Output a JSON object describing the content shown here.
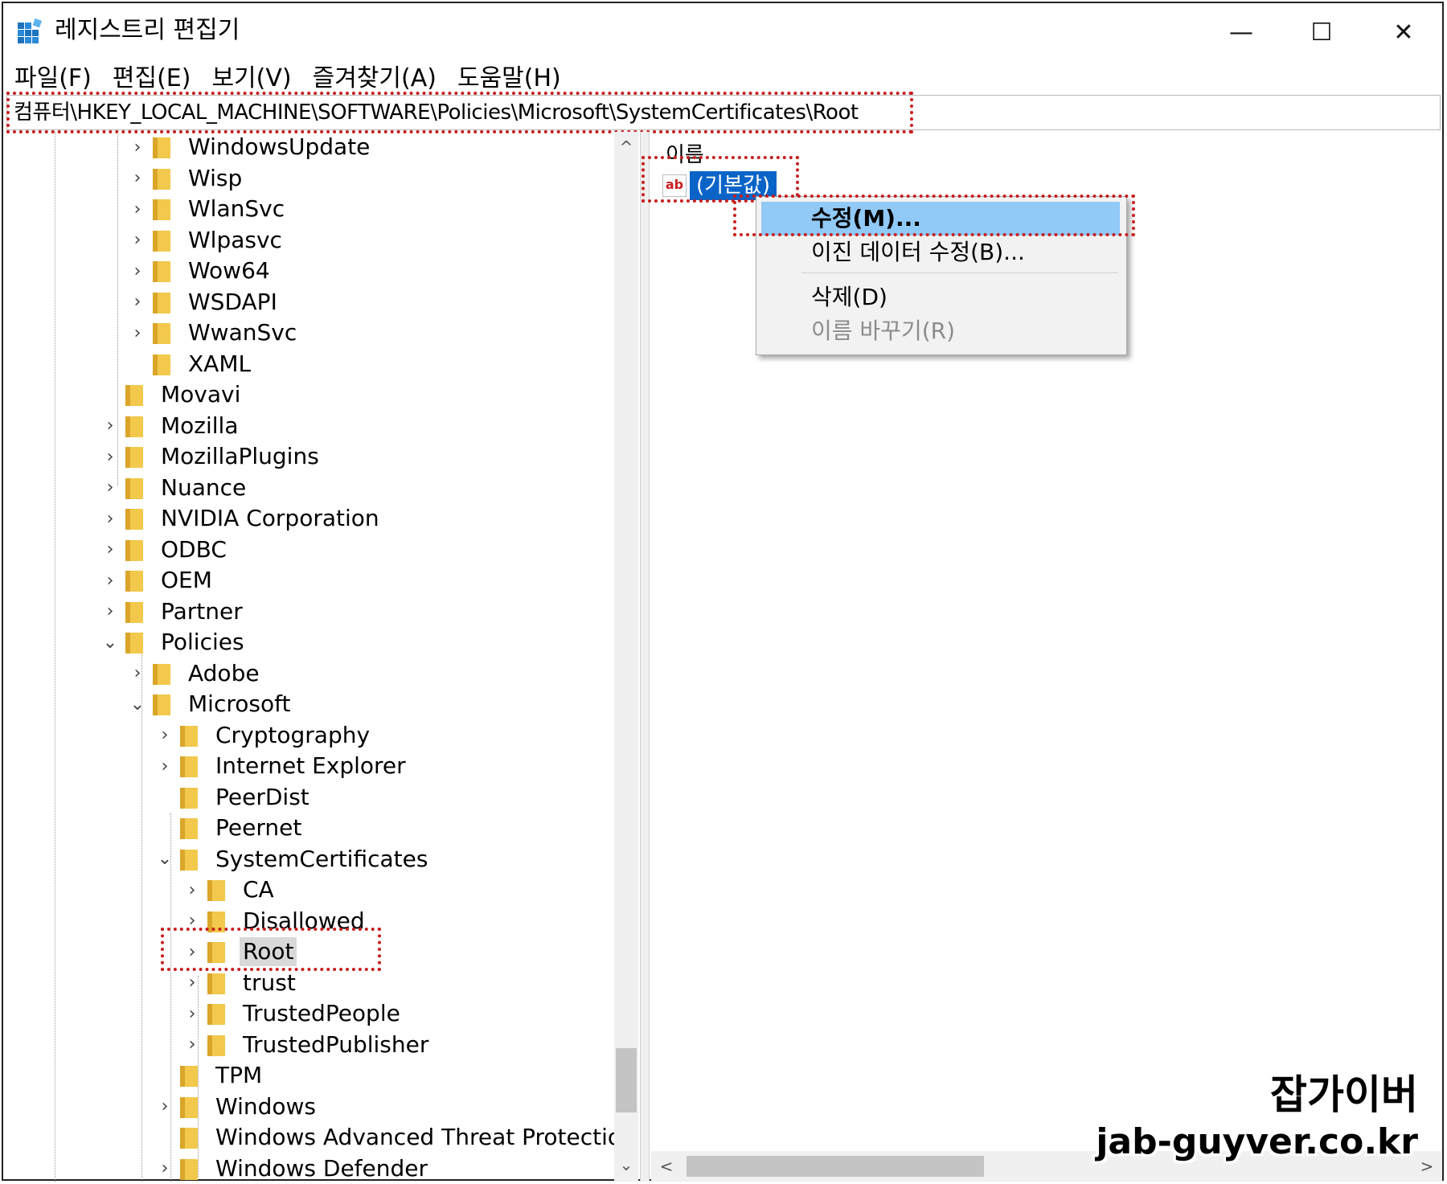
{
  "window": {
    "title": "레지스트리 편집기",
    "minimize": "—",
    "maximize": "☐",
    "close": "✕"
  },
  "menu": [
    "파일(F)",
    "편집(E)",
    "보기(V)",
    "즐겨찾기(A)",
    "도움말(H)"
  ],
  "address": "컴퓨터\\HKEY_LOCAL_MACHINE\\SOFTWARE\\Policies\\Microsoft\\SystemCertificates\\Root",
  "tree": [
    {
      "label": "WindowsUpdate",
      "expander": "›"
    },
    {
      "label": "Wisp",
      "expander": "›"
    },
    {
      "label": "WlanSvc",
      "expander": "›"
    },
    {
      "label": "Wlpasvc",
      "expander": "›"
    },
    {
      "label": "Wow64",
      "expander": "›"
    },
    {
      "label": "WSDAPI",
      "expander": "›"
    },
    {
      "label": "WwanSvc",
      "expander": "›"
    },
    {
      "label": "XAML",
      "expander": ""
    },
    {
      "label": "Movavi",
      "expander": ""
    },
    {
      "label": "Mozilla",
      "expander": "›"
    },
    {
      "label": "MozillaPlugins",
      "expander": "›"
    },
    {
      "label": "Nuance",
      "expander": "›"
    },
    {
      "label": "NVIDIA Corporation",
      "expander": "›"
    },
    {
      "label": "ODBC",
      "expander": "›"
    },
    {
      "label": "OEM",
      "expander": "›"
    },
    {
      "label": "Partner",
      "expander": "›"
    },
    {
      "label": "Policies",
      "expander": "⌄"
    },
    {
      "label": "Adobe",
      "expander": "›"
    },
    {
      "label": "Microsoft",
      "expander": "⌄"
    },
    {
      "label": "Cryptography",
      "expander": "›"
    },
    {
      "label": "Internet Explorer",
      "expander": "›"
    },
    {
      "label": "PeerDist",
      "expander": ""
    },
    {
      "label": "Peernet",
      "expander": ""
    },
    {
      "label": "SystemCertificates",
      "expander": "⌄"
    },
    {
      "label": "CA",
      "expander": "›"
    },
    {
      "label": "Disallowed",
      "expander": "›"
    },
    {
      "label": "Root",
      "expander": "›"
    },
    {
      "label": "trust",
      "expander": "›"
    },
    {
      "label": "TrustedPeople",
      "expander": "›"
    },
    {
      "label": "TrustedPublisher",
      "expander": "›"
    },
    {
      "label": "TPM",
      "expander": ""
    },
    {
      "label": "Windows",
      "expander": "›"
    },
    {
      "label": "Windows Advanced Threat Protection",
      "expander": ""
    },
    {
      "label": "Windows Defender",
      "expander": "›"
    }
  ],
  "values_pane": {
    "column_name": "이름",
    "value_icon": "ab",
    "value_name": "(기본값)"
  },
  "context_menu": {
    "modify": "수정(M)...",
    "modify_binary": "이진 데이터 수정(B)...",
    "delete": "삭제(D)",
    "rename": "이름 바꾸기(R)"
  },
  "scroll": {
    "up": "^",
    "down": "⌄",
    "left": "<",
    "right": ">"
  },
  "watermark": {
    "brand": "잡가이버",
    "url": "jab-guyver.co.kr"
  },
  "colors": {
    "highlight": "#91c9f7",
    "selected_value": "#0a64c8",
    "annotation": "#c81e1e",
    "folder": "#f2c94c"
  }
}
